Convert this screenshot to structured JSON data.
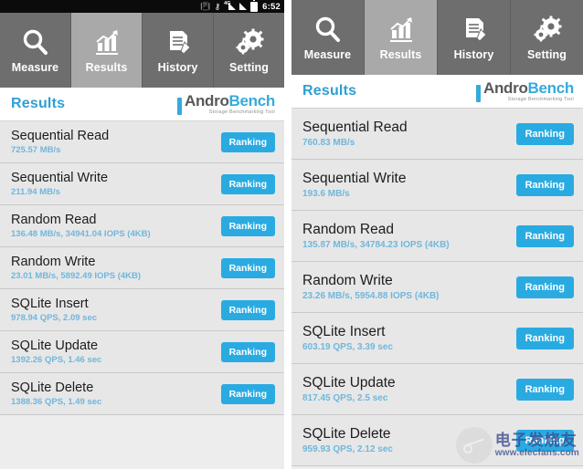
{
  "status_bar": {
    "bluetooth_icon": "bluetooth-icon",
    "vpn_key_icon": "vpn-key-icon",
    "mobile_signal_icon": "mobile-signal-4g-icon",
    "network_label": "4G",
    "wifi_signal_icon": "signal-bars-icon",
    "battery_icon": "battery-icon",
    "time": "6:52"
  },
  "tabs": [
    {
      "label": "Measure",
      "icon": "search-magnifier-icon",
      "active": false
    },
    {
      "label": "Results",
      "icon": "bar-chart-icon",
      "active": true
    },
    {
      "label": "History",
      "icon": "document-pen-icon",
      "active": false
    },
    {
      "label": "Setting",
      "icon": "gears-icon",
      "active": false
    }
  ],
  "header": {
    "title": "Results",
    "logo_andro": "Andro",
    "logo_bench": "Bench",
    "logo_tagline": "Storage Benchmarking Tool"
  },
  "ranking_button_label": "Ranking",
  "colors": {
    "accent_blue": "#29abe2",
    "title_blue": "#2e9fd4",
    "value_blue": "#6fb7dd",
    "tab_inactive": "#6e6e6e",
    "tab_active": "#a9a9a9",
    "row_background": "#e7e7e7",
    "status_bar": "#0b0b0b"
  },
  "left_panel": {
    "rows": [
      {
        "title": "Sequential Read",
        "value": "725.57 MB/s"
      },
      {
        "title": "Sequential Write",
        "value": "211.94 MB/s"
      },
      {
        "title": "Random Read",
        "value": "136.48 MB/s, 34941.04 IOPS (4KB)"
      },
      {
        "title": "Random Write",
        "value": "23.01 MB/s, 5892.49 IOPS (4KB)"
      },
      {
        "title": "SQLite Insert",
        "value": "978.94 QPS, 2.09 sec"
      },
      {
        "title": "SQLite Update",
        "value": "1392.26 QPS, 1.46 sec"
      },
      {
        "title": "SQLite Delete",
        "value": "1388.36 QPS, 1.49 sec"
      }
    ]
  },
  "right_panel": {
    "rows": [
      {
        "title": "Sequential Read",
        "value": "760.83 MB/s"
      },
      {
        "title": "Sequential Write",
        "value": "193.6 MB/s"
      },
      {
        "title": "Random Read",
        "value": "135.87 MB/s, 34784.23 IOPS (4KB)"
      },
      {
        "title": "Random Write",
        "value": "23.26 MB/s, 5954.88 IOPS (4KB)"
      },
      {
        "title": "SQLite Insert",
        "value": "603.19 QPS, 3.39 sec"
      },
      {
        "title": "SQLite Update",
        "value": "817.45 QPS, 2.5 sec"
      },
      {
        "title": "SQLite Delete",
        "value": "959.93 QPS, 2.12 sec"
      }
    ]
  },
  "watermark": {
    "chinese": "电子发烧友",
    "url": "www.elecfans.com"
  }
}
